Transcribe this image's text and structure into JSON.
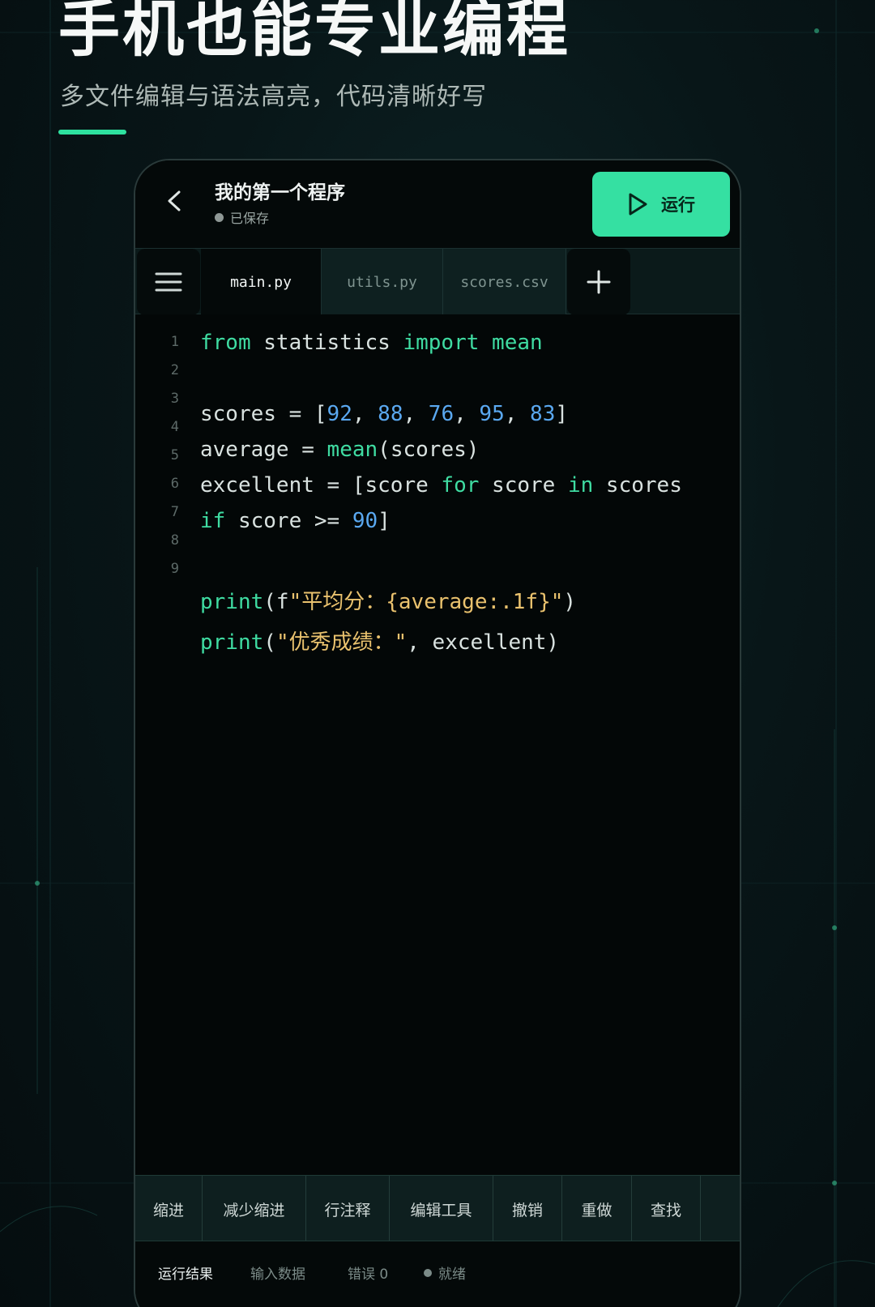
{
  "hero": {
    "title": "手机也能专业编程",
    "subtitle": "多文件编辑与语法高亮，代码清晰好写"
  },
  "header": {
    "doc_title": "我的第一个程序",
    "status": "已保存",
    "run_label": "运行"
  },
  "tabs": [
    {
      "label": "main.py",
      "active": true
    },
    {
      "label": "utils.py",
      "active": false
    },
    {
      "label": "scores.csv",
      "active": false
    }
  ],
  "icons": {
    "back": "chevron-left-icon",
    "menu": "menu-icon",
    "add": "plus-icon",
    "run": "play-icon"
  },
  "editor": {
    "line_numbers": [
      "1",
      "2",
      "3",
      "4",
      "5",
      "6",
      "7",
      "8",
      "9"
    ],
    "lines": [
      "from statistics import mean",
      "scores = [92, 88, 76, 95, 83]",
      "average = mean(scores)",
      "excellent = [score for score in scores",
      "if score >= 90]",
      "print(f\"平均分：{average:.1f}\")",
      "print(\"优秀成绩：\", excellent)"
    ]
  },
  "toolbar": [
    "缩进",
    "减少缩进",
    "行注释",
    "编辑工具",
    "撤销",
    "重做",
    "查找"
  ],
  "bottom_tabs": [
    "运行结果",
    "输入数据",
    "错误 0",
    "就绪"
  ],
  "colors": {
    "accent": "#35e0a2",
    "keyword": "#3fdca2",
    "number": "#5aa8f0",
    "string": "#eac26e"
  }
}
